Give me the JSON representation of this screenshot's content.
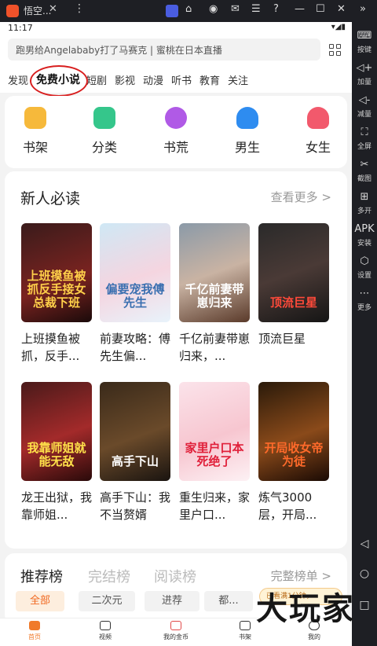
{
  "emulator": {
    "app_title": "悟空...",
    "side_items": [
      {
        "icon": "keyboard-icon",
        "label": "按键"
      },
      {
        "icon": "volume-up-icon",
        "label": "加量"
      },
      {
        "icon": "volume-down-icon",
        "label": "减量"
      },
      {
        "icon": "fullscreen-icon",
        "label": "全屏"
      },
      {
        "icon": "scissors-icon",
        "label": "截图"
      },
      {
        "icon": "multi-window-icon",
        "label": "多开"
      },
      {
        "icon": "apk-icon",
        "label": "安装"
      },
      {
        "icon": "gear-icon",
        "label": "设置"
      },
      {
        "icon": "more-icon",
        "label": "更多"
      }
    ]
  },
  "status": {
    "time": "11:17"
  },
  "search": {
    "placeholder": "跑男给Angelababy打了马赛克 | 蜜桃在日本直播"
  },
  "nav_tabs": [
    "发现",
    "免费小说",
    "短剧",
    "影视",
    "动漫",
    "听书",
    "教育",
    "关注"
  ],
  "categories": [
    "书架",
    "分类",
    "书荒",
    "男生",
    "女生"
  ],
  "new_section": {
    "title": "新人必读",
    "more": "查看更多 >",
    "books": [
      {
        "title": "上班摸鱼被抓，反手...",
        "cover_text": "上班摸鱼被抓反手接女总裁下班"
      },
      {
        "title": "前妻攻略：傅先生偏...",
        "cover_text": "偏要宠我傅先生"
      },
      {
        "title": "千亿前妻带崽归来，...",
        "cover_text": "千亿前妻带崽归来"
      },
      {
        "title": "顶流巨星",
        "cover_text": "顶流巨星"
      },
      {
        "title": "龙王出狱，我靠师姐...",
        "cover_text": "我靠师姐就能无敌"
      },
      {
        "title": "高手下山：我不当赘婿",
        "cover_text": "高手下山"
      },
      {
        "title": "重生归来，家里户口...",
        "cover_text": "家里户口本死绝了"
      },
      {
        "title": "炼气3000层，开局...",
        "cover_text": "开局收女帝为徒"
      }
    ]
  },
  "rank_section": {
    "tabs": [
      "推荐榜",
      "完结榜",
      "阅读榜"
    ],
    "more": "完整榜单 >",
    "pills": [
      "全部",
      "二次元",
      "进荐",
      "都...",
      ""
    ]
  },
  "promo_text": "已看满1分钟，",
  "watermark": "大玩家",
  "bottom_nav": [
    "首页",
    "视频",
    "我的金币",
    "书架",
    "我的"
  ],
  "colors": {
    "accent": "#f07a2a",
    "highlight_circle": "#d81e1e"
  }
}
